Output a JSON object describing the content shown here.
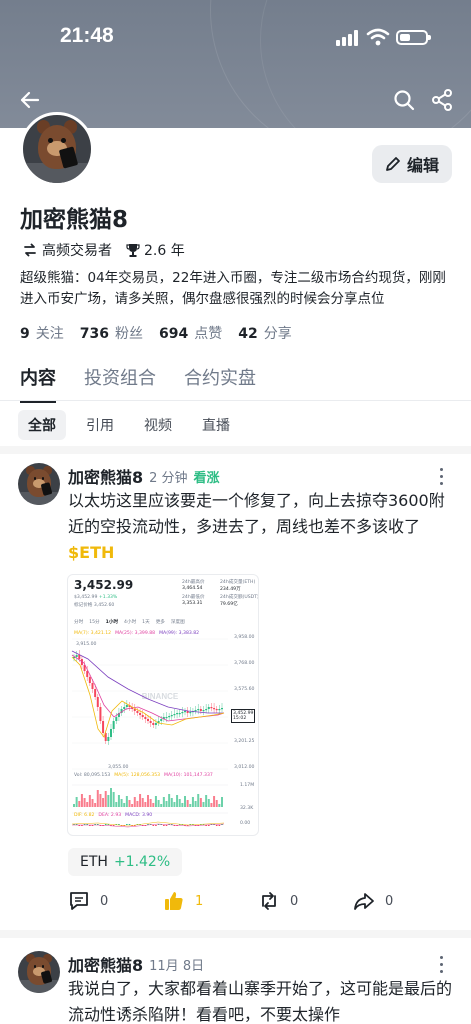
{
  "status_bar": {
    "time": "21:48"
  },
  "profile": {
    "name": "加密熊猫8",
    "tags": [
      {
        "icon": "trader-icon",
        "label": "高频交易者"
      },
      {
        "icon": "trophy-icon",
        "label": "2.6 年"
      }
    ],
    "bio": "超级熊猫：04年交易员，22年进入币圈，专注二级市场合约现货，刚刚进入币安广场，请多关照，偶尔盘感很强烈的时候会分享点位",
    "edit_label": "编辑",
    "stats": [
      {
        "value": "9",
        "label": "关注"
      },
      {
        "value": "736",
        "label": "粉丝"
      },
      {
        "value": "694",
        "label": "点赞"
      },
      {
        "value": "42",
        "label": "分享"
      }
    ]
  },
  "tabs": [
    "内容",
    "投资组合",
    "合约实盘"
  ],
  "filters": [
    "全部",
    "引用",
    "视频",
    "直播"
  ],
  "posts": [
    {
      "author": "加密熊猫8",
      "time": "2 分钟",
      "sentiment": "看涨",
      "text": "以太坊这里应该要走一个修复了，向上去掠夺3600附近的空投流动性，多进去了，周线也差不多该收了",
      "cashtag": "$ETH",
      "coin": "ETH",
      "change": "+1.42%",
      "comments": "0",
      "likes": "1",
      "reposts": "0",
      "shares": "0"
    },
    {
      "author": "加密熊猫8",
      "time": "11月 8日",
      "text": "我说白了，大家都看着山寨季开始了，这可能是最后的流动性诱杀陷阱！看看吧，不要太操作"
    }
  ],
  "chart_image": {
    "price": "3,452.99",
    "sub_price": "$3,452.99",
    "sub_change": "+1.33%",
    "mark_label": "标记价格",
    "mark_value": "3,452.60",
    "stats": [
      "24h最高价",
      "3,464.54",
      "24h最低价",
      "3,353.31",
      "24h成交量(ETH)",
      "234.49万",
      "24h成交额(USDT)",
      "79.69亿"
    ],
    "intervals": [
      "分时",
      "15分",
      "1小时",
      "4小时",
      "1天",
      "更多",
      "深度图"
    ],
    "ma_line": [
      "MA(7): 3,421.12",
      "MA(25): 3,399.88",
      "MA(99): 3,383.82"
    ],
    "y_labels": [
      "3,958.00",
      "3,768.00",
      "3,575.60",
      "3,201.25",
      "3,012.00"
    ],
    "high_label": "3,915.00",
    "low_label": "3,055.00",
    "last_label": "3,452.99",
    "last_time": "15:02",
    "vol_line": [
      "Vol: 80,095.153",
      "MA(5): 128,056.353",
      "MA(10): 101,147.337"
    ],
    "vol_labels": [
      "1.17M",
      "32.3K"
    ],
    "macd_line": [
      "DIF: 6.82",
      "DEA: 2.93",
      "MACD: 3.90"
    ],
    "macd_labels": [
      "32.3K",
      "0.00"
    ],
    "watermark": "BINANCE"
  }
}
